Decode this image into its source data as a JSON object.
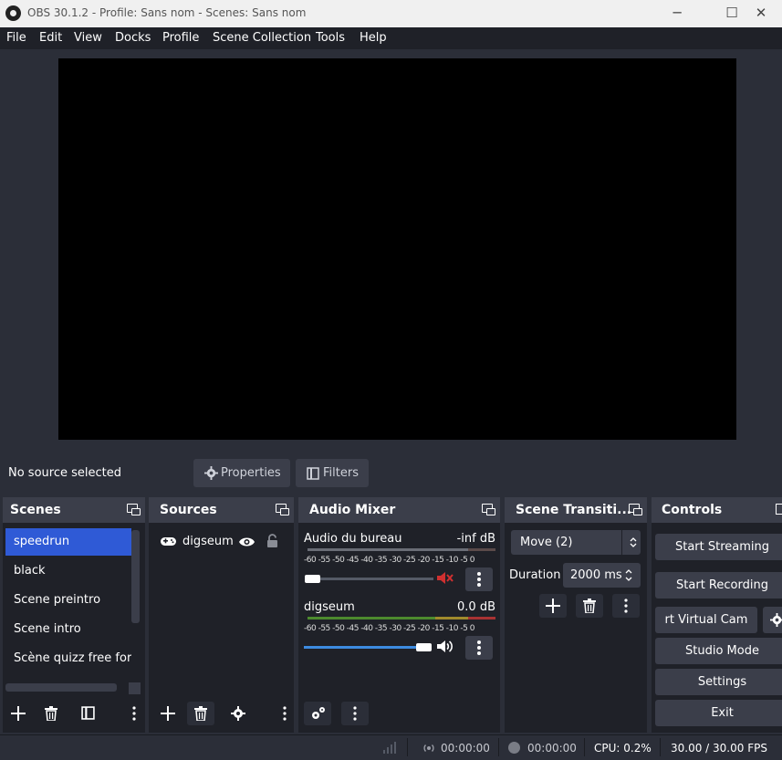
{
  "window": {
    "title": "OBS 30.1.2 - Profile: Sans nom - Scenes: Sans nom",
    "minimize": "─",
    "maximize": "☐",
    "close": "✕"
  },
  "menu": [
    "File",
    "Edit",
    "View",
    "Docks",
    "Profile",
    "Scene Collection",
    "Tools",
    "Help"
  ],
  "context": {
    "status": "No source selected",
    "properties": "Properties",
    "filters": "Filters"
  },
  "scenes": {
    "title": "Scenes",
    "items": [
      "speedrun",
      "black",
      "Scene preintro",
      "Scene intro",
      "Scène quizz free for al"
    ],
    "selected": 0
  },
  "sources": {
    "title": "Sources",
    "items": [
      {
        "name": "digseum"
      }
    ]
  },
  "mixer": {
    "title": "Audio Mixer",
    "scale": [
      "-60",
      "-55",
      "-50",
      "-45",
      "-40",
      "-35",
      "-30",
      "-25",
      "-20",
      "-15",
      "-10",
      "-5",
      "0"
    ],
    "channels": [
      {
        "name": "Audio du bureau",
        "level": "-inf dB",
        "volume": 0.0,
        "muted": true
      },
      {
        "name": "digseum",
        "level": "0.0 dB",
        "volume": 1.0,
        "muted": false
      }
    ]
  },
  "transitions": {
    "title": "Scene Transiti...",
    "current": "Move (2)",
    "duration_label": "Duration",
    "duration": "2000 ms"
  },
  "controls": {
    "title": "Controls",
    "start_streaming": "Start Streaming",
    "start_recording": "Start Recording",
    "virtual_cam": "rt Virtual Cam",
    "studio_mode": "Studio Mode",
    "settings": "Settings",
    "exit": "Exit"
  },
  "status": {
    "stream_time": "00:00:00",
    "rec_time": "00:00:00",
    "cpu": "CPU: 0.2%",
    "fps": "30.00 / 30.00 FPS"
  },
  "colors": {
    "accent": "#2f5ad6",
    "muted": "#d03030",
    "slider": "#3d8be0"
  }
}
